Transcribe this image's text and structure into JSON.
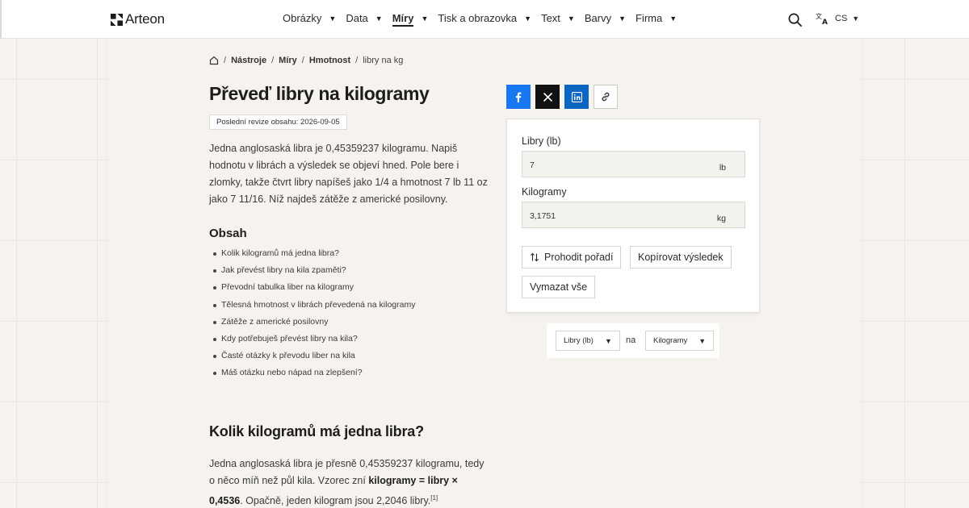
{
  "header": {
    "brand": "Arteon",
    "nav": [
      {
        "label": "Obrázky",
        "active": false
      },
      {
        "label": "Data",
        "active": false
      },
      {
        "label": "Míry",
        "active": true
      },
      {
        "label": "Tisk a obrazovka",
        "active": false
      },
      {
        "label": "Text",
        "active": false
      },
      {
        "label": "Barvy",
        "active": false
      },
      {
        "label": "Firma",
        "active": false
      }
    ],
    "language": "CS",
    "icons": {
      "search": "search-icon",
      "language": "translate-icon",
      "home": "home-icon"
    }
  },
  "breadcrumb": {
    "items": [
      "Nástroje",
      "Míry",
      "Hmotnost"
    ],
    "current": "libry na kg"
  },
  "page": {
    "title": "Převeď libry na kilogramy",
    "revision": "Poslední revize obsahu: 2026-09-05",
    "intro": "Jedna anglosaská libra je 0,45359237 kilogramu. Napiš hodnotu v librách a výsledek se objeví hned. Pole bere i zlomky, takže čtvrt libry napíšeš jako 1/4 a hmotnost 7 lb 11 oz jako 7 11/16. Níž najdeš zátěže z americké posilovny."
  },
  "toc": {
    "title": "Obsah",
    "items": [
      "Kolik kilogramů má jedna libra?",
      "Jak převést libry na kila zpaměti?",
      "Převodní tabulka liber na kilogramy",
      "Tělesná hmotnost v librách převedená na kilogramy",
      "Zátěže z americké posilovny",
      "Kdy potřebuješ převést libry na kila?",
      "Časté otázky k převodu liber na kila",
      "Máš otázku nebo nápad na zlepšení?"
    ]
  },
  "section": {
    "heading": "Kolik kilogramů má jedna libra?",
    "text_1": "Jedna anglosaská libra je přesně 0,45359237 kilogramu, tedy o něco míň než půl kila. Vzorec zní ",
    "formula": "kilogramy = libry × 0,4536",
    "text_2": ". Opačně, jeden kilogram jsou 2,2046 libry.",
    "footnote": "[1]"
  },
  "share": {
    "buttons": [
      "facebook-icon",
      "x-icon",
      "linkedin-icon",
      "link-icon"
    ],
    "colors": {
      "facebook": "#1877f2",
      "x": "#111111",
      "linkedin": "#0a66c2"
    }
  },
  "converter": {
    "from_label": "Libry (lb)",
    "from_value": "7",
    "from_unit": "lb",
    "to_label": "Kilogramy",
    "to_value": "3,1751",
    "to_unit": "kg",
    "swap_label": "Prohodit pořadí",
    "copy_label": "Kopírovat výsledek",
    "clear_label": "Vymazat vše"
  },
  "units": {
    "from": "Libry (lb)",
    "joiner": "na",
    "to": "Kilogramy"
  }
}
